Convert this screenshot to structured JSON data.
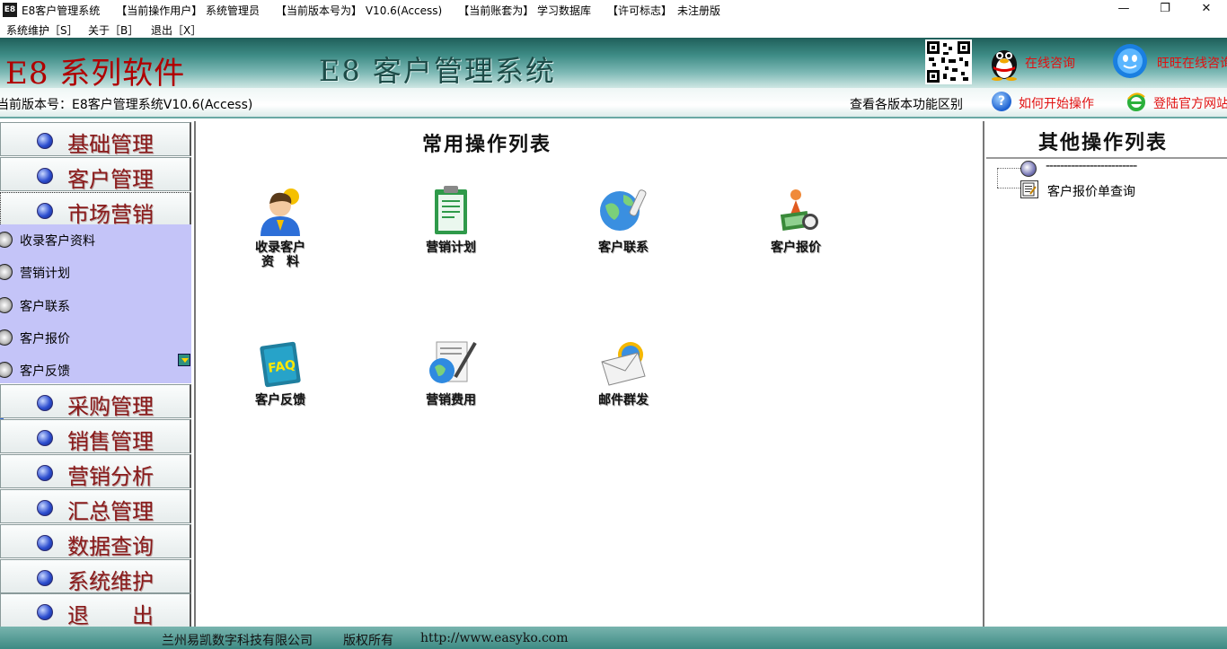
{
  "window": {
    "app_icon_text": "E8",
    "title": "E8客户管理系统　　【当前操作用户】 系统管理员　　【当前版本号为】 V10.6(Access)　　【当前账套为】 学习数据库　　【许可标志】　未注册版",
    "minimize": "—",
    "maximize": "❐",
    "close": "✕"
  },
  "menu": {
    "items": [
      "系统维护［S］",
      "关于［B］",
      "退出［X］"
    ]
  },
  "banner": {
    "brand": "E8 系列软件",
    "system_name": "E8 客户管理系统",
    "qq_link": "在线咨询",
    "ali_link": "旺旺在线咨询"
  },
  "infobar": {
    "version": "当前版本号：E8客户管理系统V10.6(Access)",
    "compare": "查看各版本功能区别",
    "howto": "如何开始操作",
    "official": "登陆官方网站"
  },
  "nav": {
    "top": [
      "基础管理",
      "客户管理",
      "市场营销"
    ],
    "sub": [
      "收录客户资料",
      "营销计划",
      "客户联系",
      "客户报价",
      "客户反馈"
    ],
    "bottom": [
      "采购管理",
      "销售管理",
      "营销分析",
      "汇总管理",
      "数据查询",
      "系统维护",
      "退　　出"
    ]
  },
  "center": {
    "heading": "常用操作列表",
    "tiles": [
      "收录客户\n资　料",
      "营销计划",
      "客户联系",
      "客户报价",
      "客户反馈",
      "营销费用",
      "邮件群发"
    ]
  },
  "right": {
    "heading": "其他操作列表",
    "tree_root": "-------------------------",
    "tree_child": "客户报价单查询"
  },
  "footer": {
    "company": "兰州易凯数字科技有限公司",
    "rights": "版权所有",
    "url": "http://www.easyko.com"
  },
  "colors": {
    "banner_teal": "#3e8c86",
    "brand_red": "#b00000",
    "nav_text": "#8a1a1a",
    "sub_panel": "#c4c4f8"
  }
}
